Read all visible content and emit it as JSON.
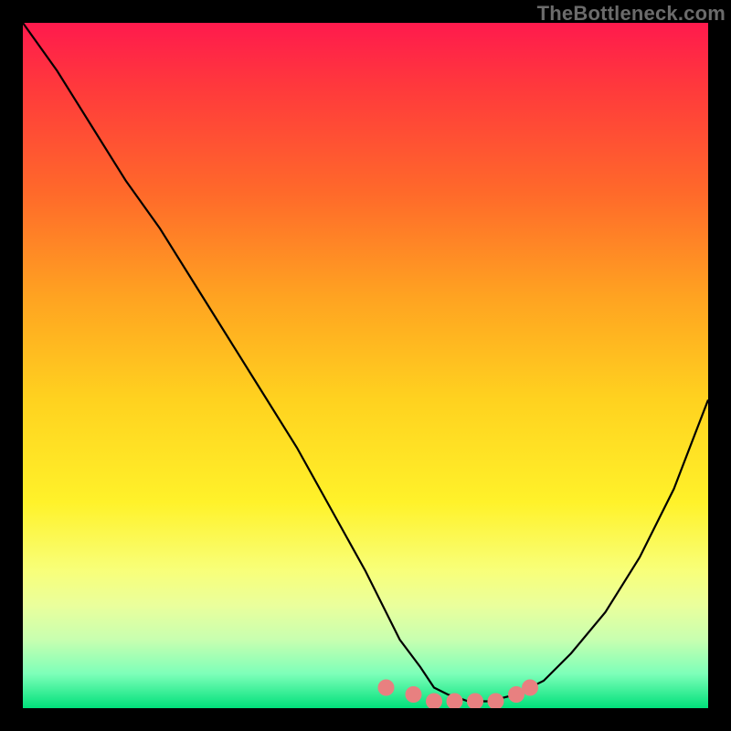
{
  "watermark": "TheBottleneck.com",
  "chart_data": {
    "type": "line",
    "title": "",
    "xlabel": "",
    "ylabel": "",
    "xlim": [
      0,
      100
    ],
    "ylim": [
      0,
      100
    ],
    "series": [
      {
        "name": "bottleneck-curve",
        "x": [
          0,
          5,
          10,
          15,
          20,
          25,
          30,
          35,
          40,
          45,
          50,
          53,
          55,
          58,
          60,
          62,
          65,
          68,
          72,
          76,
          80,
          85,
          90,
          95,
          100
        ],
        "values": [
          100,
          93,
          85,
          77,
          70,
          62,
          54,
          46,
          38,
          29,
          20,
          14,
          10,
          6,
          3,
          2,
          1,
          1,
          2,
          4,
          8,
          14,
          22,
          32,
          45
        ]
      },
      {
        "name": "highlight-dots",
        "x": [
          53,
          57,
          60,
          63,
          66,
          69,
          72,
          74
        ],
        "values": [
          3,
          2,
          1,
          1,
          1,
          1,
          2,
          3
        ]
      }
    ],
    "colors": {
      "curve": "#000000",
      "dots": "#e88080",
      "gradient_top": "#ff1a4d",
      "gradient_bottom": "#00e07a"
    }
  }
}
